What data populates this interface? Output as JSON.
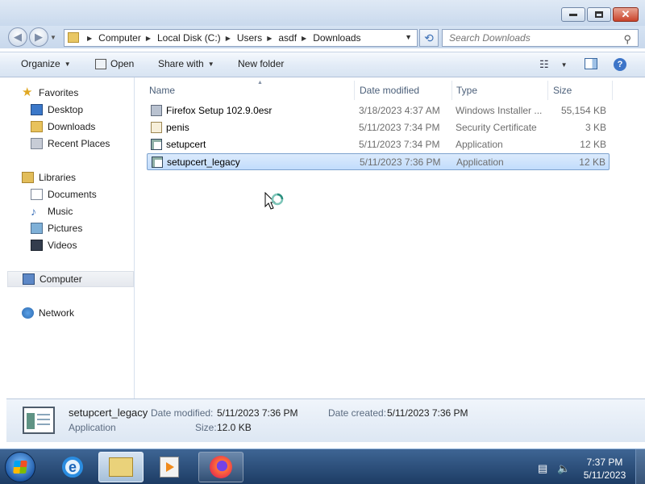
{
  "address": {
    "crumbs": [
      "Computer",
      "Local Disk (C:)",
      "Users",
      "asdf",
      "Downloads"
    ],
    "search_placeholder": "Search Downloads"
  },
  "toolbar": {
    "organize": "Organize",
    "open": "Open",
    "share_with": "Share with",
    "new_folder": "New folder"
  },
  "navigation": {
    "favorites": "Favorites",
    "desktop": "Desktop",
    "downloads": "Downloads",
    "recent_places": "Recent Places",
    "libraries": "Libraries",
    "documents": "Documents",
    "music": "Music",
    "pictures": "Pictures",
    "videos": "Videos",
    "computer": "Computer",
    "network": "Network"
  },
  "columns": {
    "name": "Name",
    "date_modified": "Date modified",
    "type": "Type",
    "size": "Size"
  },
  "files": [
    {
      "name": "Firefox Setup 102.9.0esr",
      "date": "3/18/2023 4:37 AM",
      "type": "Windows Installer ...",
      "size": "55,154 KB",
      "icon": "installer-icon"
    },
    {
      "name": "penis",
      "date": "5/11/2023 7:34 PM",
      "type": "Security Certificate",
      "size": "3 KB",
      "icon": "certificate-icon"
    },
    {
      "name": "setupcert",
      "date": "5/11/2023 7:34 PM",
      "type": "Application",
      "size": "12 KB",
      "icon": "application-icon"
    },
    {
      "name": "setupcert_legacy",
      "date": "5/11/2023 7:36 PM",
      "type": "Application",
      "size": "12 KB",
      "icon": "application-icon"
    }
  ],
  "details": {
    "name": "setupcert_legacy",
    "type": "Application",
    "date_modified_label": "Date modified:",
    "date_modified": "5/11/2023 7:36 PM",
    "size_label": "Size:",
    "size": "12.0 KB",
    "date_created_label": "Date created:",
    "date_created": "5/11/2023 7:36 PM"
  },
  "clock": {
    "time": "7:37 PM",
    "date": "5/11/2023"
  },
  "colors": {
    "selection": "#cce4fc",
    "taskbar": "#1d3c64"
  }
}
